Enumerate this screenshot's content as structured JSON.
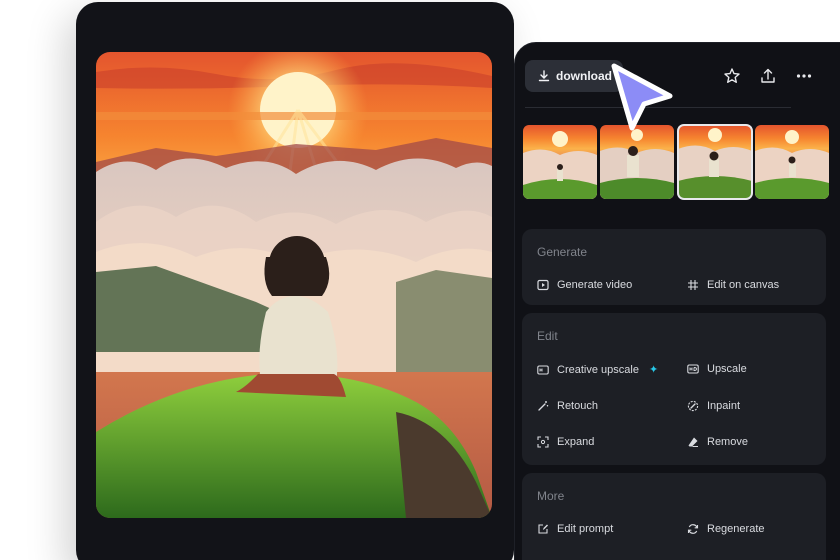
{
  "toolbar": {
    "download_label": "download",
    "icons": [
      "download-icon",
      "star-icon",
      "share-icon",
      "more-icon"
    ]
  },
  "thumbnails": [
    {
      "name": "variation-1",
      "selected": false
    },
    {
      "name": "variation-2",
      "selected": false
    },
    {
      "name": "variation-3",
      "selected": true
    },
    {
      "name": "variation-4",
      "selected": false
    }
  ],
  "sections": {
    "generate": {
      "title": "Generate",
      "actions": [
        "Generate video",
        "Edit on canvas"
      ]
    },
    "edit": {
      "title": "Edit",
      "actions": [
        "Creative upscale",
        "Upscale",
        "Retouch",
        "Inpaint",
        "Expand",
        "Remove"
      ]
    },
    "more": {
      "title": "More",
      "actions": [
        "Edit prompt",
        "Regenerate"
      ]
    }
  },
  "colors": {
    "panel_bg": "#101116",
    "section_bg": "#1d1f25",
    "accent_cursor": "#8c8cf6",
    "sparkle": "#27c8e8"
  }
}
